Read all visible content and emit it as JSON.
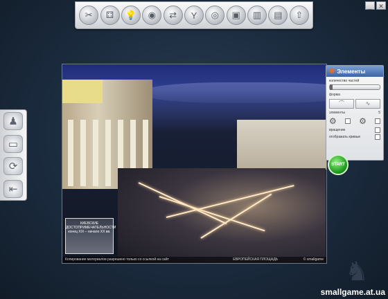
{
  "toolbar": {
    "buttons": [
      {
        "icon": "tools-icon",
        "glyph": "✂"
      },
      {
        "icon": "puzzle-pieces-icon",
        "glyph": "⚃"
      },
      {
        "icon": "lightbulb-icon",
        "glyph": "💡"
      },
      {
        "icon": "disc-icon",
        "glyph": "◉"
      },
      {
        "icon": "shuffle-icon",
        "glyph": "⇄"
      },
      {
        "icon": "magnet-icon",
        "glyph": "Y"
      },
      {
        "icon": "target-icon",
        "glyph": "◎"
      },
      {
        "icon": "save-icon",
        "glyph": "▣"
      },
      {
        "icon": "load-icon",
        "glyph": "▥"
      },
      {
        "icon": "gallery-icon",
        "glyph": "▤"
      },
      {
        "icon": "upload-icon",
        "glyph": "⇧"
      }
    ]
  },
  "window_controls": {
    "minimize": "_",
    "close": "✕"
  },
  "sidebar": {
    "buttons": [
      {
        "icon": "robot-icon",
        "glyph": "♟"
      },
      {
        "icon": "camera-icon",
        "glyph": "▭"
      },
      {
        "icon": "refresh-icon",
        "glyph": "⟳"
      },
      {
        "icon": "exit-icon",
        "glyph": "⇤"
      }
    ]
  },
  "photo": {
    "plaque_title": "КИЕВСКИЕ ДОСТОПРИМЕЧАТЕЛЬНОСТИ",
    "plaque_sub": "конец XIX – начало XX вв.",
    "caption_left": "Копирование материалов разрешено только со ссылкой на сайт",
    "caption_right": "ЕВРОПЕЙСКАЯ ПЛОЩАДЬ",
    "caption_copy": "© smallgame"
  },
  "panel": {
    "title": "Элементы",
    "count_label": "количество частей",
    "shape_label": "форма",
    "elements_label": "элементы",
    "elements_value": "5",
    "rotation_label": "вращение",
    "curves_label": "отображать кривые",
    "start_label": "START"
  },
  "watermark": "smallgame.at.ua"
}
